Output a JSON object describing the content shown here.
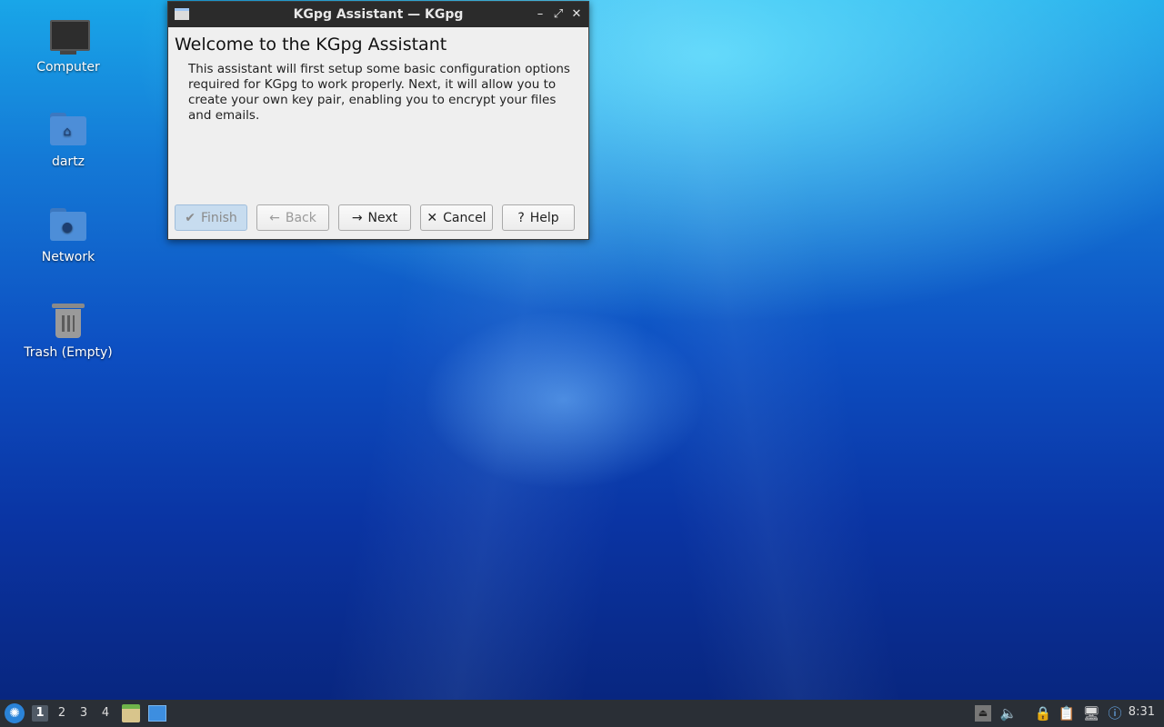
{
  "desktop": {
    "icons": [
      {
        "label": "Computer",
        "icon": "computer-icon"
      },
      {
        "label": "dartz",
        "icon": "home-folder-icon"
      },
      {
        "label": "Network",
        "icon": "network-folder-icon"
      },
      {
        "label": "Trash (Empty)",
        "icon": "trash-icon"
      }
    ]
  },
  "window": {
    "title": "KGpg Assistant — KGpg",
    "heading": "Welcome to the KGpg Assistant",
    "description": "This assistant will first setup some basic configuration options required for KGpg to work properly. Next, it will allow you to create your own key pair, enabling you to encrypt your files and emails.",
    "buttons": {
      "finish": "Finish",
      "back": "Back",
      "next": "Next",
      "cancel": "Cancel",
      "help": "Help"
    }
  },
  "taskbar": {
    "workspaces": [
      "1",
      "2",
      "3",
      "4"
    ],
    "active_workspace": "1",
    "clock": "8:31"
  },
  "colors": {
    "titlebar": "#2b2b2b",
    "taskbar": "#2a2f36",
    "accent": "#2a83d8"
  }
}
